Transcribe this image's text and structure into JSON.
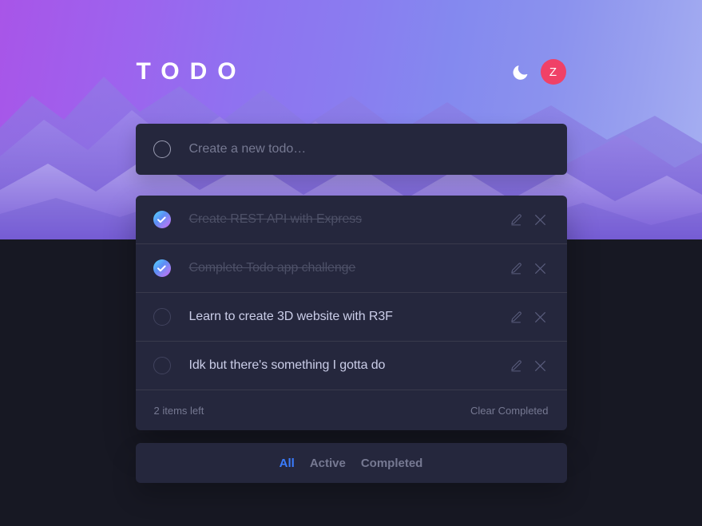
{
  "header": {
    "title": "TODO",
    "theme_toggle_icon": "moon-icon",
    "avatar_initial": "Z",
    "avatar_color": "#f04167"
  },
  "create": {
    "placeholder": "Create a new todo…",
    "value": ""
  },
  "todos": [
    {
      "label": "Create REST API with Express",
      "done": true
    },
    {
      "label": "Complete Todo app challenge",
      "done": true
    },
    {
      "label": "Learn to create 3D website with R3F",
      "done": false
    },
    {
      "label": "Idk but there's something I gotta do",
      "done": false
    }
  ],
  "row_icons": {
    "edit": "pencil-icon",
    "delete": "close-icon"
  },
  "footer": {
    "items_left": "2 items left",
    "clear_label": "Clear Completed"
  },
  "filters": [
    {
      "label": "All",
      "active": true
    },
    {
      "label": "Active",
      "active": false
    },
    {
      "label": "Completed",
      "active": false
    }
  ],
  "colors": {
    "page_background": "#171823",
    "card_background": "#25273d",
    "divider": "#393a4c",
    "text_primary": "#cacde8",
    "text_muted": "#767992",
    "text_done": "#4d5067",
    "accent_blue": "#3a7cfd",
    "check_gradient_from": "#57ddff",
    "check_gradient_to": "#c058f3"
  }
}
